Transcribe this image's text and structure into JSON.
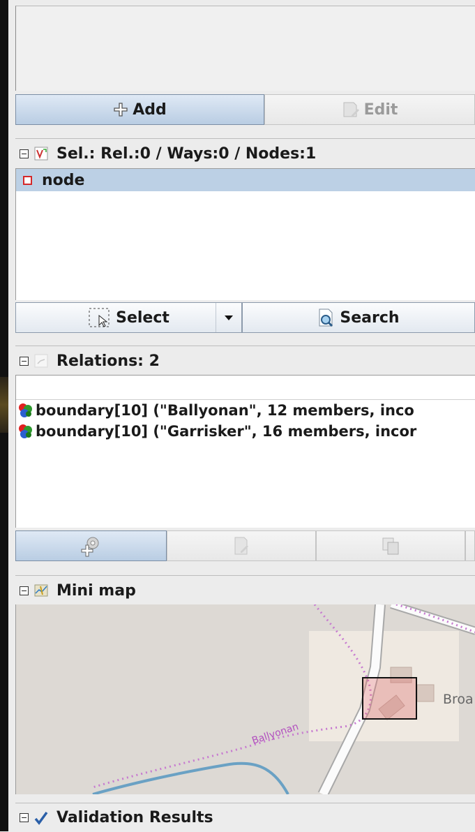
{
  "tags_panel": {
    "add_label": "Add",
    "edit_label": "Edit"
  },
  "selection_panel": {
    "title": "Sel.: Rel.:0 / Ways:0 / Nodes:1",
    "items": [
      {
        "label": "node"
      }
    ],
    "select_label": "Select",
    "search_label": "Search"
  },
  "relations_panel": {
    "title": "Relations: 2",
    "items": [
      {
        "label": "boundary[10] (\"Ballyonan\", 12 members, inco"
      },
      {
        "label": "boundary[10] (\"Garrisker\", 16 members, incor"
      }
    ]
  },
  "minimap_panel": {
    "title": "Mini map",
    "map_labels": {
      "road_label": "Ballyonan",
      "place_label": "Broa"
    }
  },
  "validation_panel": {
    "title": "Validation Results"
  },
  "colors": {
    "selected_row": "#bcd0e5",
    "primary_button": "#b9cde3",
    "node_icon": "#d4282a",
    "map_background": "#ddd9d4",
    "boundary_line": "#c77ad0",
    "river": "#6aa1c4"
  },
  "icons": {
    "add": "plus-icon",
    "edit": "edit-document-icon",
    "select": "select-area-icon",
    "dropdown": "dropdown-arrow-icon",
    "search": "search-document-icon",
    "relation": "multipolygon-relation-icon",
    "minimap": "map-icon",
    "validation": "checkmark-icon"
  }
}
